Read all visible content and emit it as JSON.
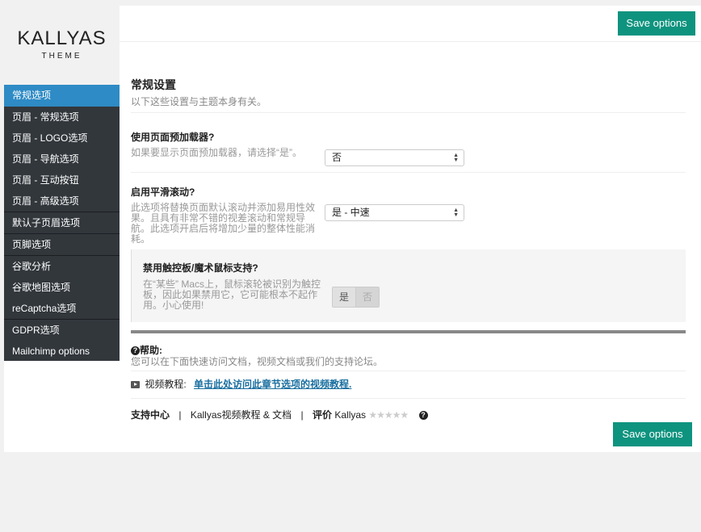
{
  "brand": {
    "name": "KALLYAS",
    "subtitle": "THEME"
  },
  "header": {
    "save_label": "Save options"
  },
  "sidebar": {
    "items": [
      {
        "label": "常规选项"
      },
      {
        "label": "页眉 - 常规选项"
      },
      {
        "label": "页眉 - LOGO选项"
      },
      {
        "label": "页眉 - 导航选项"
      },
      {
        "label": "页眉 - 互动按钮"
      },
      {
        "label": "页眉 - 高级选项"
      },
      {
        "label": "默认子页眉选项"
      },
      {
        "label": "页脚选项"
      },
      {
        "label": "谷歌分析"
      },
      {
        "label": "谷歌地图选项"
      },
      {
        "label": "reCaptcha选项"
      },
      {
        "label": "GDPR选项"
      },
      {
        "label": "Mailchimp options"
      }
    ]
  },
  "main": {
    "section_title": "常规设置",
    "section_desc": "以下这些设置与主题本身有关。",
    "options": [
      {
        "title": "使用页面预加载器?",
        "desc": "如果要显示页面预加载器，请选择“是”。",
        "value": "否"
      },
      {
        "title": "启用平滑滚动?",
        "desc": "此选项将替换页面默认滚动并添加易用性效果。且具有非常不错的视差滚动和常规导航。此选项开启后将增加少量的整体性能消耗。",
        "value": "是 - 中速"
      },
      {
        "title": "禁用触控板/魔术鼠标支持?",
        "desc": "在“某些” Macs上，鼠标滚轮被识别为触控板，因此如果禁用它，它可能根本不起作用。小心使用!",
        "toggle_yes": "是",
        "toggle_no": "否"
      }
    ]
  },
  "help": {
    "title": "帮助:",
    "desc": "您可以在下面快速访问文档，视频文档或我们的支持论坛。",
    "video_label": "视频教程:",
    "video_link": "单击此处访问此章节选项的视频教程.",
    "support": "支持中心",
    "sep": "|",
    "docs": "Kallyas视频教程 & 文档",
    "rate": "评价",
    "rate_target": "Kallyas",
    "stars": "★★★★★"
  },
  "colors": {
    "accent": "#0e937f",
    "sidebar_bg": "#32373c",
    "active": "#2e8bc5"
  }
}
